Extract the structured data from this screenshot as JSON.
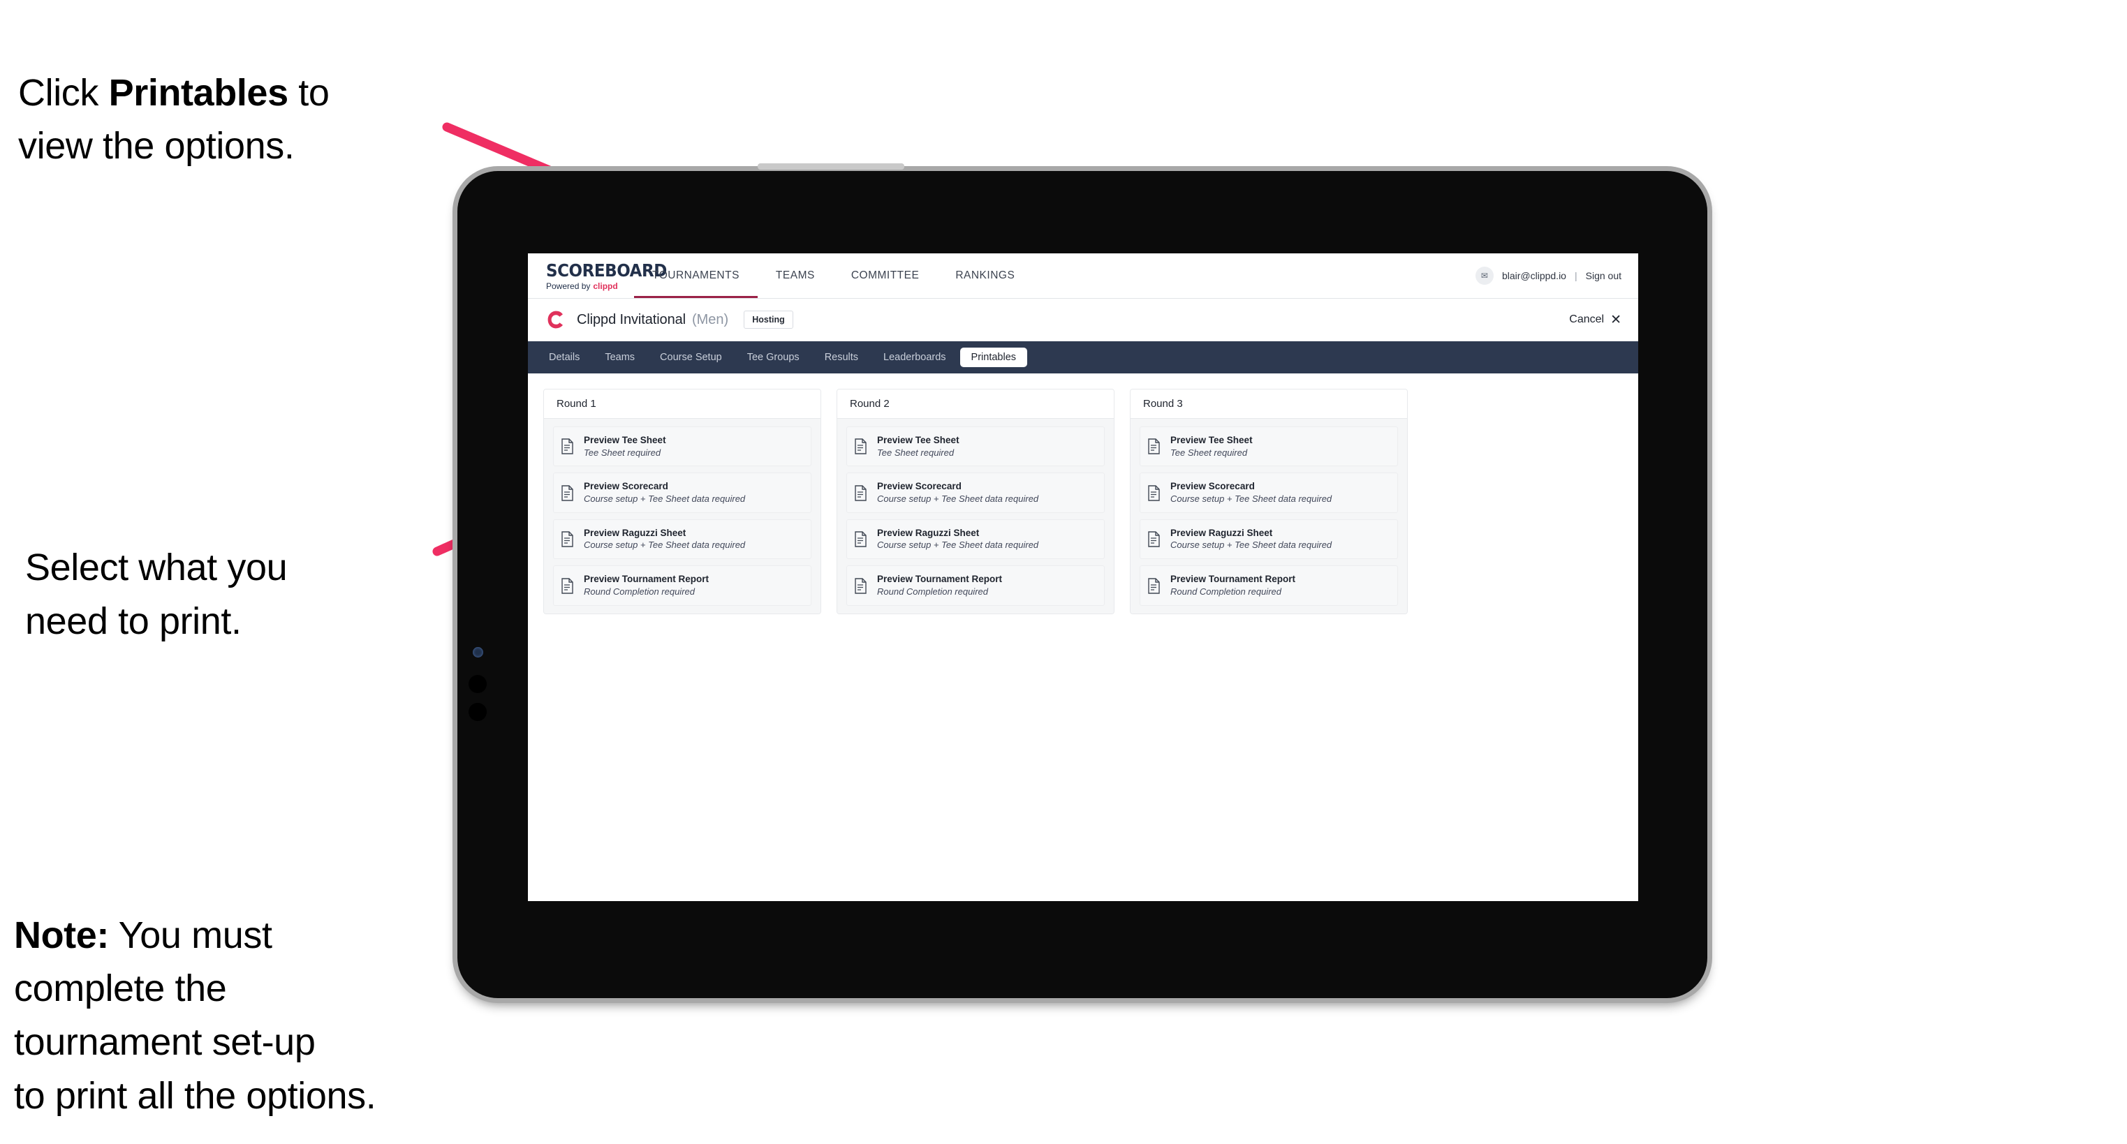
{
  "annotations": {
    "click_printables": {
      "prefix": "Click ",
      "bold": "Printables",
      "suffix": " to\nview the options."
    },
    "select_print": "Select what you\n need to print.",
    "note": {
      "bold": "Note:",
      "text": " You must\ncomplete the\ntournament set-up\nto print all the options."
    }
  },
  "colors": {
    "arrow_pink": "#ef2e63",
    "navy_tabbar": "#2d3950",
    "brand_crimson": "#9b2247",
    "clippd_pink": "#e0315b",
    "card_grey": "#f5f6f7"
  },
  "app": {
    "brand": {
      "wordmark": "SCOREBOARD",
      "powered_by": "Powered by",
      "powered_by_brand": "clippd"
    },
    "global_nav": {
      "items": [
        {
          "label": "TOURNAMENTS",
          "active": true
        },
        {
          "label": "TEAMS",
          "active": false
        },
        {
          "label": "COMMITTEE",
          "active": false
        },
        {
          "label": "RANKINGS",
          "active": false
        }
      ],
      "avatar_glyph": "✉",
      "user_email": "blair@clippd.io",
      "separator": "|",
      "sign_out": "Sign out"
    },
    "tournament": {
      "logo_letter": "C",
      "name": "Clippd Invitational",
      "gender": "(Men)",
      "status_badge": "Hosting",
      "cancel_label": "Cancel",
      "cancel_icon": "✕"
    },
    "section_tabs": [
      {
        "label": "Details",
        "active": false
      },
      {
        "label": "Teams",
        "active": false
      },
      {
        "label": "Course Setup",
        "active": false
      },
      {
        "label": "Tee Groups",
        "active": false
      },
      {
        "label": "Results",
        "active": false
      },
      {
        "label": "Leaderboards",
        "active": false
      },
      {
        "label": "Printables",
        "active": true
      }
    ],
    "printables": {
      "rounds": [
        {
          "title": "Round 1",
          "items": [
            {
              "title": "Preview Tee Sheet",
              "requirement": "Tee Sheet required"
            },
            {
              "title": "Preview Scorecard",
              "requirement": "Course setup + Tee Sheet data required"
            },
            {
              "title": "Preview Raguzzi Sheet",
              "requirement": "Course setup + Tee Sheet data required"
            },
            {
              "title": "Preview Tournament Report",
              "requirement": "Round Completion required"
            }
          ]
        },
        {
          "title": "Round 2",
          "items": [
            {
              "title": "Preview Tee Sheet",
              "requirement": "Tee Sheet required"
            },
            {
              "title": "Preview Scorecard",
              "requirement": "Course setup + Tee Sheet data required"
            },
            {
              "title": "Preview Raguzzi Sheet",
              "requirement": "Course setup + Tee Sheet data required"
            },
            {
              "title": "Preview Tournament Report",
              "requirement": "Round Completion required"
            }
          ]
        },
        {
          "title": "Round 3",
          "items": [
            {
              "title": "Preview Tee Sheet",
              "requirement": "Tee Sheet required"
            },
            {
              "title": "Preview Scorecard",
              "requirement": "Course setup + Tee Sheet data required"
            },
            {
              "title": "Preview Raguzzi Sheet",
              "requirement": "Course setup + Tee Sheet data required"
            },
            {
              "title": "Preview Tournament Report",
              "requirement": "Round Completion required"
            }
          ]
        }
      ]
    }
  }
}
